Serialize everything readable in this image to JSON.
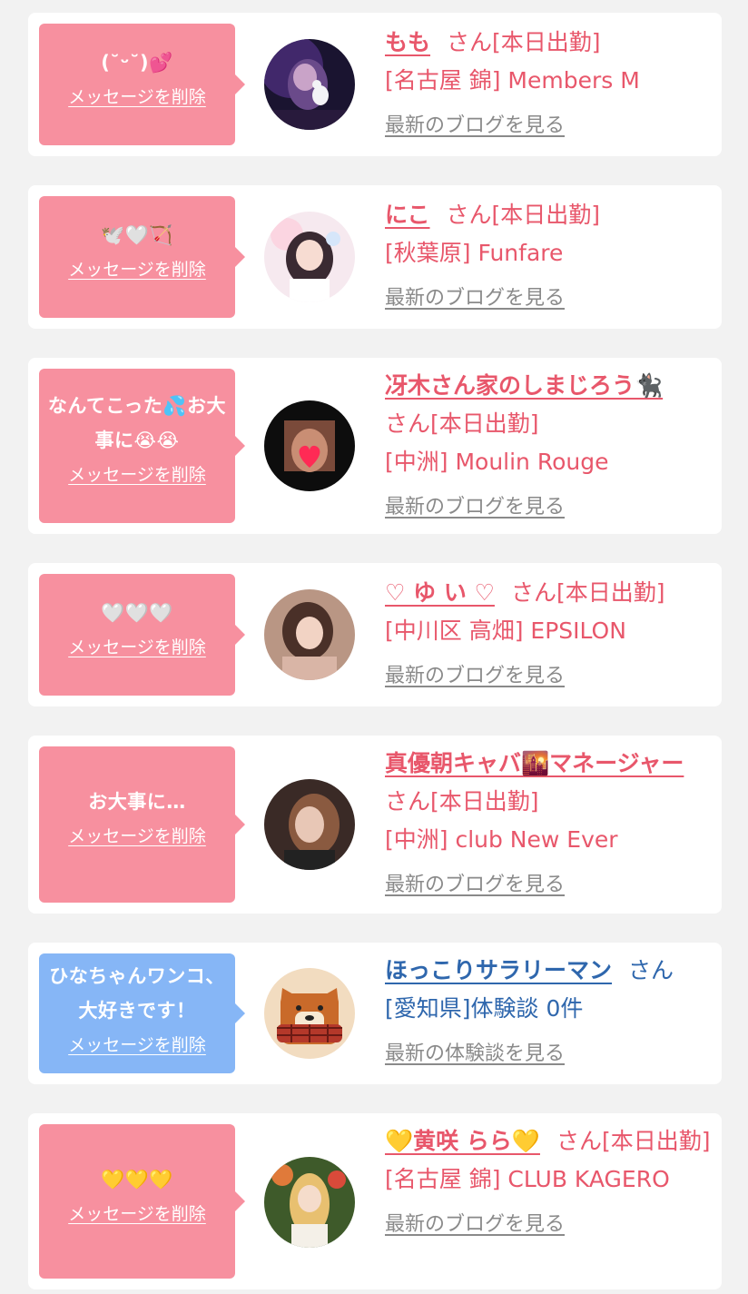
{
  "colors": {
    "bubble_pink": "#f7909f",
    "bubble_blue": "#86b6f6",
    "name_pink": "#e8576b",
    "name_blue": "#2f67ad",
    "link_gray": "#8a8a8a"
  },
  "delete_label": "メッセージを削除",
  "items": [
    {
      "message": "(˘ᵕ˘)💕",
      "name": "もも",
      "san": "さん",
      "status": "[本日出勤]",
      "shop": "[名古屋 錦] Members M",
      "link": "最新のブログを見る",
      "avatar_icon": "avatar-photo-momo"
    },
    {
      "message": "🕊️🤍🏹",
      "name": "にこ",
      "san": "さん",
      "status": "[本日出勤]",
      "shop": "[秋葉原] Funfare",
      "link": "最新のブログを見る",
      "avatar_icon": "avatar-photo-niko"
    },
    {
      "message": "なんてこった💦お大事に😭😭",
      "name": "冴木さん家のしまじろう🐈‍⬛",
      "san": "さん",
      "status": "[本日出勤]",
      "shop": "[中洲] Moulin Rouge",
      "link": "最新のブログを見る",
      "avatar_icon": "avatar-photo-shimajiro"
    },
    {
      "message": "🤍🤍🤍",
      "name": "♡ ゆ い ♡",
      "san": "さん",
      "status": "[本日出勤]",
      "shop": "[中川区 高畑] EPSILON",
      "link": "最新のブログを見る",
      "avatar_icon": "avatar-photo-yui"
    },
    {
      "message": "お大事に…",
      "name": "真優朝キャバ🌇マネージャー",
      "san": "さん",
      "status": "[本日出勤]",
      "shop": "[中洲] club New Ever",
      "link": "最新のブログを見る",
      "avatar_icon": "avatar-photo-mayu"
    },
    {
      "message": "ひなちゃんワンコ、大好きです！",
      "name": "ほっこりサラリーマン",
      "san": "さん",
      "status": "",
      "shop": "[愛知県]体験談 0件",
      "link": "最新の体験談を見る",
      "avatar_icon": "avatar-shiba-dog-illustration"
    },
    {
      "message": "💛💛💛",
      "name": "💛黄咲 らら💛",
      "san": "さん",
      "status": "[本日出勤]",
      "shop": "[名古屋 錦] CLUB KAGERO",
      "link": "最新のブログを見る",
      "avatar_icon": "avatar-photo-rara"
    }
  ]
}
